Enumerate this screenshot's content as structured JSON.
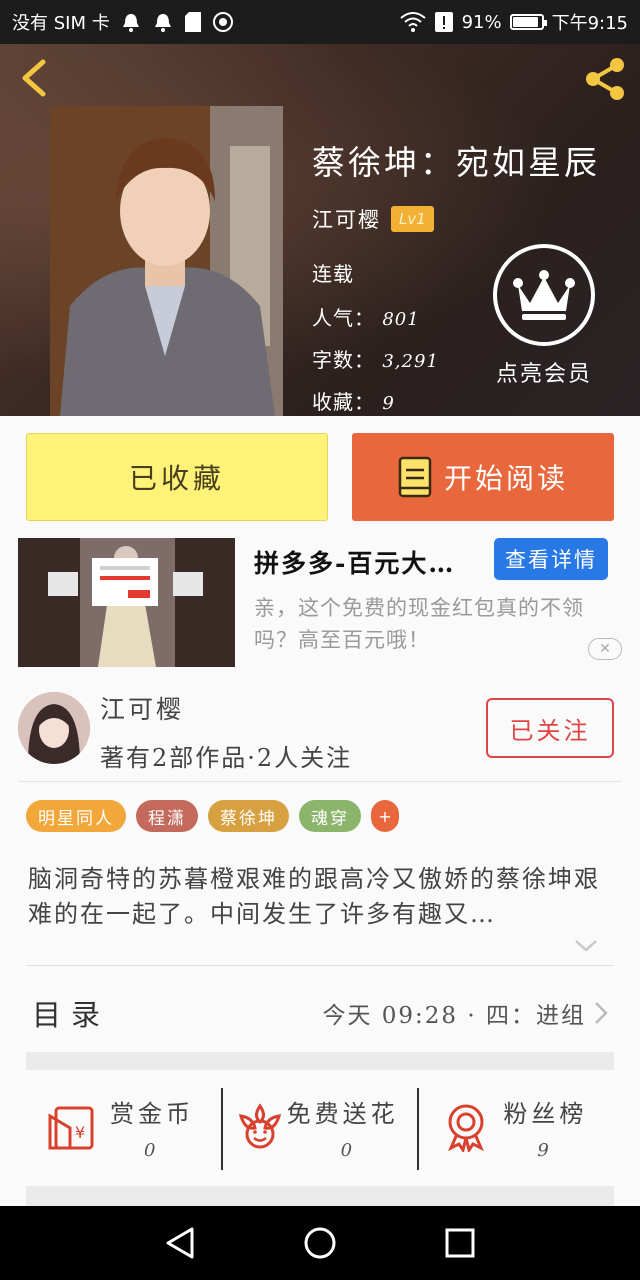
{
  "status_bar": {
    "carrier": "没有 SIM 卡",
    "battery": "91%",
    "battery_level": 0.91,
    "time": "下午9:15"
  },
  "book": {
    "title": "蔡徐坤：宛如星辰",
    "author": "江可樱",
    "level": "Lv1",
    "status": "连载",
    "popularity_label": "人气：",
    "popularity": "801",
    "word_count_label": "字数：",
    "word_count": "3,291",
    "favorites_label": "收藏：",
    "favorites": "9",
    "member_label": "点亮会员"
  },
  "buttons": {
    "collected": "已收藏",
    "start_reading": "开始阅读"
  },
  "ad": {
    "title": "拼多多-百元大…",
    "detail_button": "查看详情",
    "description": "亲，这个免费的现金红包真的不领吗？高至百元哦！",
    "close_label": "✕"
  },
  "author_card": {
    "name": "江可樱",
    "stats": "著有2部作品·2人关注",
    "follow_button": "已关注"
  },
  "tags": [
    {
      "label": "明星同人",
      "color": "#f2a73b"
    },
    {
      "label": "程潇",
      "color": "#c46a5c"
    },
    {
      "label": "蔡徐坤",
      "color": "#d7a040"
    },
    {
      "label": "魂穿",
      "color": "#8ab56a"
    }
  ],
  "tag_add_label": "+",
  "synopsis": "脑洞奇特的苏暮橙艰难的跟高冷又傲娇的蔡徐坤艰难的在一起了。中间发生了许多有趣又…",
  "catalog": {
    "label": "目录",
    "latest": "今天 09:28 · 四：进组"
  },
  "actions": [
    {
      "label": "赏金币",
      "count": "0",
      "icon": "coin-envelope-icon"
    },
    {
      "label": "免费送花",
      "count": "0",
      "icon": "flower-icon"
    },
    {
      "label": "粉丝榜",
      "count": "9",
      "icon": "medal-icon"
    }
  ],
  "colors": {
    "accent_orange": "#e8673c",
    "collected_yellow": "#fef378",
    "ad_blue": "#2878e6",
    "follow_red": "#e04545",
    "icon_red": "#d9412f"
  }
}
